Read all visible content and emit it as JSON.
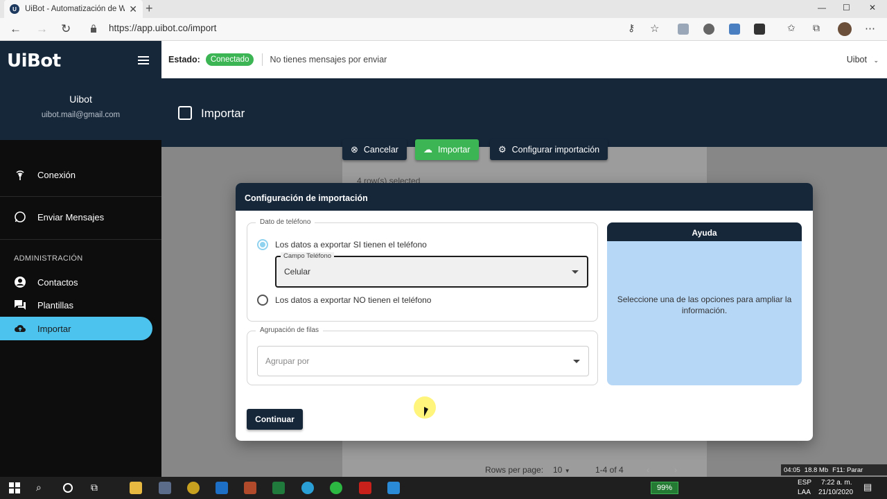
{
  "browser": {
    "tab_title": "UiBot - Automatización de Whats",
    "url": "https://app.uibot.co/import"
  },
  "sidebar": {
    "logo": "UiBot",
    "user_name": "Uibot",
    "user_email": "uibot.mail@gmail.com",
    "items": [
      {
        "label": "Conexión",
        "icon": "wifi-icon"
      },
      {
        "label": "Enviar Mensajes",
        "icon": "whatsapp-icon"
      }
    ],
    "admin_section": "ADMINISTRACIÓN",
    "admin_items": [
      {
        "label": "Contactos",
        "icon": "account-icon"
      },
      {
        "label": "Plantillas",
        "icon": "chat-icon"
      },
      {
        "label": "Importar",
        "icon": "cloud-upload-icon",
        "active": true
      }
    ]
  },
  "topbar": {
    "estado_label": "Estado:",
    "status": "Conectado",
    "message": "No tienes mensajes por enviar",
    "user": "Uibot"
  },
  "page": {
    "title": "Importar",
    "buttons": {
      "cancel": "Cancelar",
      "import": "Importar",
      "config": "Configurar importación"
    },
    "rows_selected": "4 row(s) selected",
    "rows_per_page_label": "Rows per page:",
    "rows_per_page": "10",
    "range": "1-4 of 4"
  },
  "modal": {
    "title": "Configuración de importación",
    "phone_group": {
      "legend": "Dato de teléfono",
      "option_yes": "Los datos a exportar SI tienen el teléfono",
      "option_no": "Los datos a exportar NO tienen el teléfono",
      "selected": "yes",
      "field_label": "Campo Teléfono",
      "field_value": "Celular"
    },
    "group_rows": {
      "legend": "Agrupación de filas",
      "placeholder": "Agrupar por"
    },
    "help": {
      "title": "Ayuda",
      "text": "Seleccione una de las opciones para ampliar la información."
    },
    "continue": "Continuar"
  },
  "taskbar": {
    "battery": "99%",
    "lang": "ESP",
    "layout": "LAA",
    "time": "7:22 a. m.",
    "date": "21/10/2020"
  },
  "recorder_osd": {
    "elapsed": "04:05",
    "size": "18.8 Mb",
    "hint": "F11: Parar"
  },
  "colors": {
    "navy": "#16273a",
    "accent": "#4cc3ee",
    "success": "#3cb554"
  }
}
